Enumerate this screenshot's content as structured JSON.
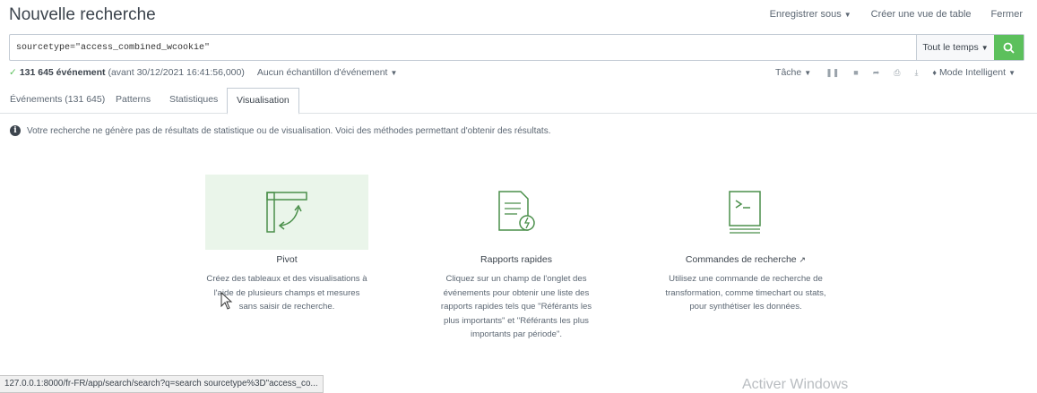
{
  "header": {
    "title": "Nouvelle recherche",
    "save_as": "Enregistrer sous",
    "create_table": "Créer une vue de table",
    "close": "Fermer"
  },
  "search": {
    "query": "sourcetype=\"access_combined_wcookie\"",
    "time_range": "Tout le temps"
  },
  "status": {
    "event_count": "131 645 événement",
    "date_text": "(avant 30/12/2021 16:41:56,000)",
    "sampling": "Aucun échantillon d'événement",
    "job": "Tâche",
    "mode": "Mode Intelligent"
  },
  "tabs": [
    {
      "label": "Événements (131 645)"
    },
    {
      "label": "Patterns"
    },
    {
      "label": "Statistiques"
    },
    {
      "label": "Visualisation"
    }
  ],
  "info_message": "Votre recherche ne génère pas de résultats de statistique ou de visualisation. Voici des méthodes permettant d'obtenir des résultats.",
  "cards": [
    {
      "title": "Pivot",
      "desc": "Créez des tableaux et des visualisations à l'aide de plusieurs champs et mesures sans saisir de recherche."
    },
    {
      "title": "Rapports rapides",
      "desc": "Cliquez sur un champ de l'onglet des événements pour obtenir une liste des rapports rapides tels que \"Référants les plus importants\" et \"Référants les plus importants par période\"."
    },
    {
      "title": "Commandes de recherche",
      "desc": "Utilisez une commande de recherche de transformation, comme timechart ou stats, pour synthétiser les données."
    }
  ],
  "statusbar_url": "127.0.0.1:8000/fr-FR/app/search/search?q=search sourcetype%3D\"access_co...",
  "watermark": "Activer Windows",
  "colors": {
    "accent_green": "#5cc05c",
    "highlight_bg": "#eaf5ea",
    "icon_color": "#4a8f4a"
  }
}
